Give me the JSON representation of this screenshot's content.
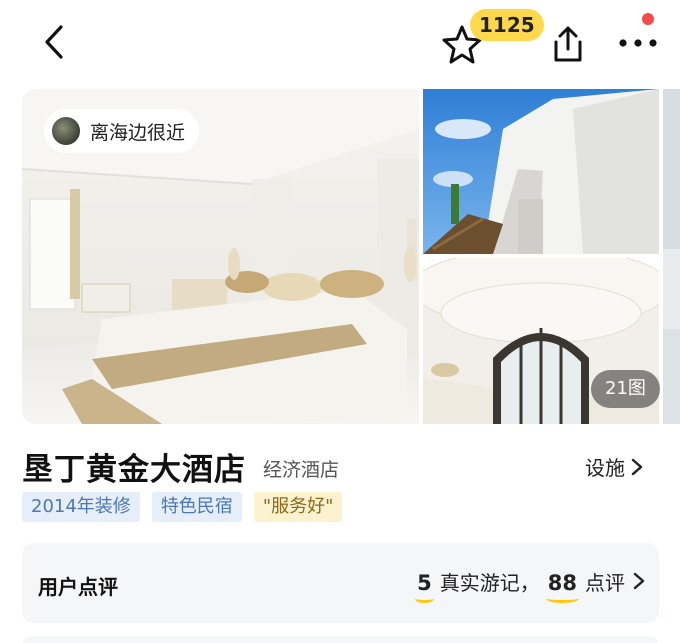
{
  "header": {
    "back_icon": "chevron-left-icon",
    "favorite_icon": "star-outline-icon",
    "favorite_count": "1125",
    "share_icon": "share-icon",
    "more_icon": "more-dots-icon",
    "notification_dot_color": "#f44a4a",
    "badge_color": "#ffd84d"
  },
  "gallery": {
    "distance_tag": "离海边很近",
    "photo_count": "21图"
  },
  "hotel": {
    "name": "垦丁黄金大酒店",
    "type": "经济酒店",
    "facility_link": "设施",
    "tags": [
      {
        "label": "2014年装修",
        "style": "blue"
      },
      {
        "label": "特色民宿",
        "style": "blue"
      },
      {
        "label": "\"服务好\"",
        "style": "yellow"
      }
    ]
  },
  "reviews": {
    "title": "用户点评",
    "travel_notes_count": "5",
    "travel_notes_label": "真实游记，",
    "review_count": "88",
    "review_label": "点评",
    "accent_color": "#ffc60a"
  }
}
